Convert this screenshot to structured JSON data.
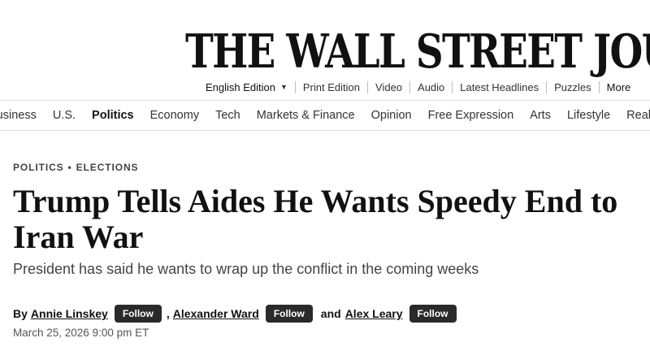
{
  "masthead": {
    "title": "THE WALL STREET JOURNAL"
  },
  "utility_nav": {
    "edition": "English Edition",
    "edition_caret": "▼",
    "items": [
      "Print Edition",
      "Video",
      "Audio",
      "Latest Headlines",
      "Puzzles"
    ],
    "more": "More"
  },
  "section_nav": {
    "items": [
      "Business",
      "U.S.",
      "Politics",
      "Economy",
      "Tech",
      "Markets & Finance",
      "Opinion",
      "Free Expression",
      "Arts",
      "Lifestyle",
      "Real Estate"
    ],
    "active": "Politics"
  },
  "article": {
    "flashline": {
      "section": "POLITICS",
      "separator": "•",
      "subsection": "ELECTIONS"
    },
    "headline": "Trump Tells Aides He Wants Speedy End to Iran War",
    "dek": "President has said he wants to wrap up the conflict in the coming weeks",
    "byline": {
      "prefix": "By",
      "authors": [
        "Annie Linskey",
        "Alexander Ward",
        "Alex Leary"
      ],
      "follow_label": "Follow",
      "comma": ",",
      "and": "and"
    },
    "timestamp": "March 25, 2026 9:00 pm ET"
  }
}
